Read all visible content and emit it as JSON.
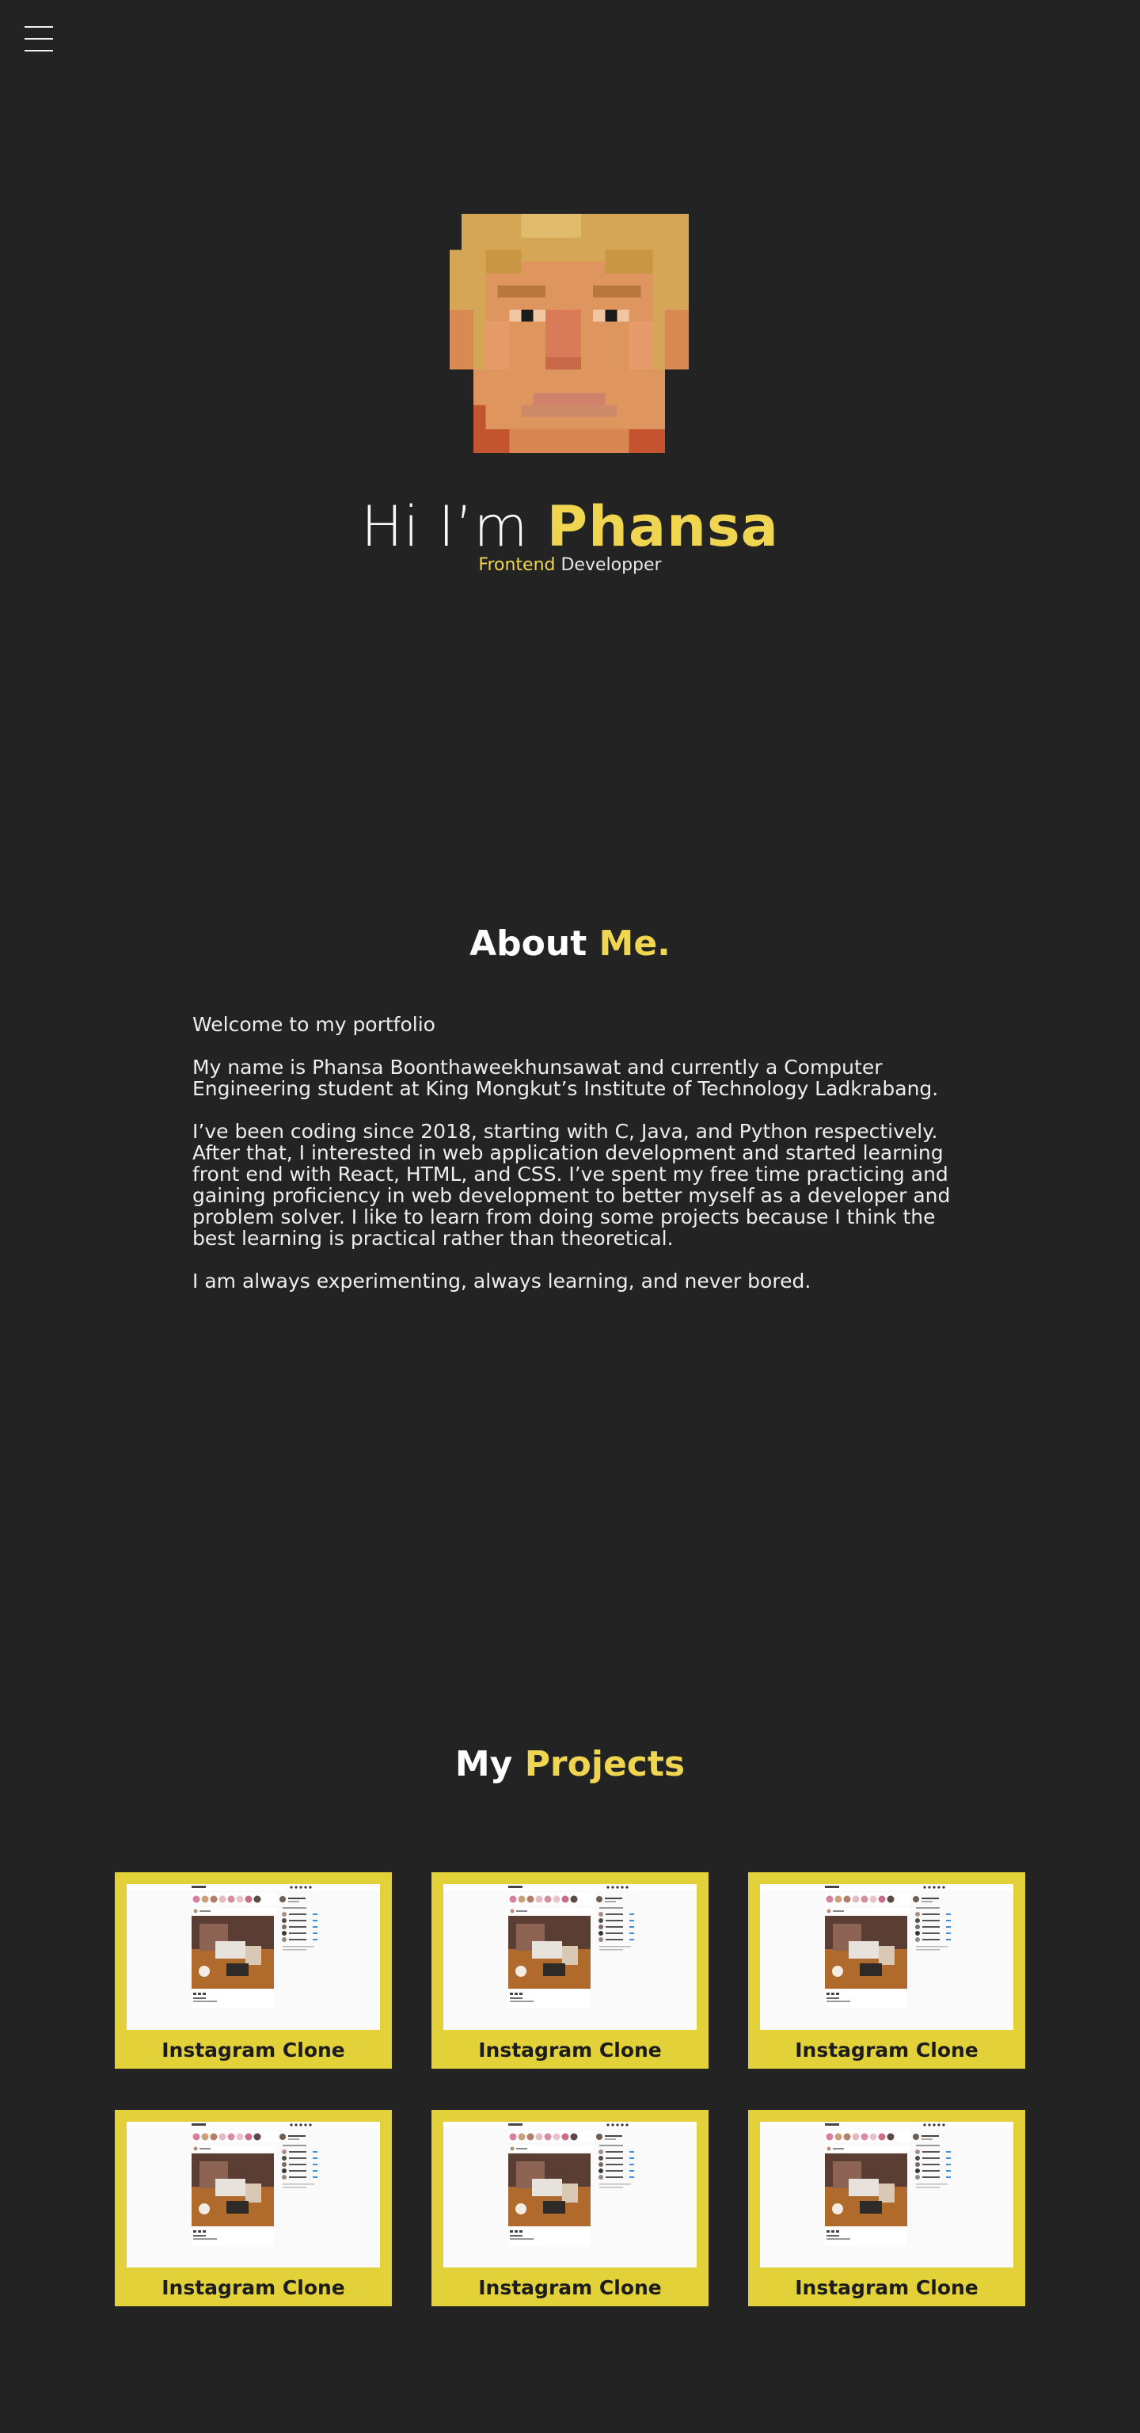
{
  "hero": {
    "greeting": "Hi I’m ",
    "name": "Phansa",
    "role_accent": "Frontend",
    "role_rest": " Developper"
  },
  "about": {
    "title_main": "About ",
    "title_accent": "Me.",
    "paragraphs": [
      "Welcome to my portfolio",
      "My name is Phansa Boonthaweekhunsawat and currently a Computer Engineering student at King Mongkut’s Institute of Technology Ladkrabang.",
      "I’ve been coding since 2018, starting with C, Java, and Python respectively. After that, I interested in web application development and started learning front end with React, HTML, and CSS. I’ve spent my free time practicing and gaining proficiency in web development to better myself as a developer and problem solver. I like to learn from doing some projects because I think the best learning is practical rather than theoretical.",
      "I am always experimenting, always learning, and never bored."
    ]
  },
  "projects": {
    "title_main": "My ",
    "title_accent": "Projects",
    "items": [
      {
        "label": "Instagram Clone"
      },
      {
        "label": "Instagram Clone"
      },
      {
        "label": "Instagram Clone"
      },
      {
        "label": "Instagram Clone"
      },
      {
        "label": "Instagram Clone"
      },
      {
        "label": "Instagram Clone"
      }
    ]
  },
  "icons": {
    "menu": "hamburger-menu-icon"
  },
  "colors": {
    "background": "#232323",
    "accent": "#f0d550",
    "card": "#e3d13a",
    "text": "#f2f2f2"
  }
}
